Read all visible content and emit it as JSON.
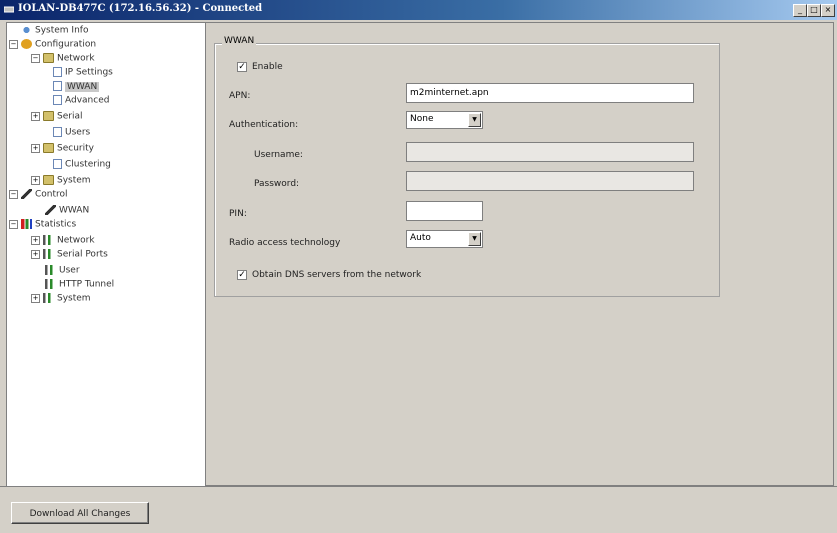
{
  "window": {
    "title": "IOLAN-DB477C (172.16.56.32) - Connected",
    "controls": {
      "minimize": "_",
      "maximize": "□",
      "close": "×"
    }
  },
  "tree": {
    "items": [
      {
        "label": "System Info",
        "icon": "system-info-icon"
      },
      {
        "label": "Configuration",
        "icon": "configuration-icon",
        "expander": "−"
      },
      {
        "label": "Network",
        "icon": "folder-icon",
        "expander": "−"
      },
      {
        "label": "IP Settings",
        "icon": "page-icon"
      },
      {
        "label": "WWAN",
        "icon": "page-icon",
        "selected": true
      },
      {
        "label": "Advanced",
        "icon": "page-icon"
      },
      {
        "label": "Serial",
        "icon": "folder-icon",
        "expander": "+"
      },
      {
        "label": "Users",
        "icon": "page-icon"
      },
      {
        "label": "Security",
        "icon": "folder-icon",
        "expander": "+"
      },
      {
        "label": "Clustering",
        "icon": "page-icon"
      },
      {
        "label": "System",
        "icon": "folder-icon",
        "expander": "+"
      },
      {
        "label": "Control",
        "icon": "wrench-icon",
        "expander": "−"
      },
      {
        "label": "WWAN",
        "icon": "wrench-icon"
      },
      {
        "label": "Statistics",
        "icon": "bar-chart-icon",
        "expander": "−"
      },
      {
        "label": "Network",
        "icon": "bar-chart-icon",
        "expander": "+"
      },
      {
        "label": "Serial Ports",
        "icon": "bar-chart-icon",
        "expander": "+"
      },
      {
        "label": "User",
        "icon": "bar-chart-icon"
      },
      {
        "label": "HTTP Tunnel",
        "icon": "bar-chart-icon"
      },
      {
        "label": "System",
        "icon": "bar-chart-icon",
        "expander": "+"
      }
    ]
  },
  "wwan": {
    "group_title": "WWAN",
    "enable_label": "Enable",
    "enable_checked": true,
    "apn_label": "APN:",
    "apn_value": "m2minternet.apn",
    "auth_label": "Authentication:",
    "auth_value": "None",
    "username_label": "Username:",
    "username_value": "",
    "password_label": "Password:",
    "password_value": "",
    "pin_label": "PIN:",
    "pin_value": "",
    "rat_label": "Radio access technology",
    "rat_value": "Auto",
    "dns_label": "Obtain DNS servers from the network",
    "dns_checked": true,
    "check_glyph": "✓",
    "arrow_glyph": "▼"
  },
  "footer": {
    "download_label": "Download All Changes"
  },
  "colors": {
    "title_start": "#0a246a",
    "title_end": "#a6caf0",
    "face": "#d4d0c8"
  }
}
